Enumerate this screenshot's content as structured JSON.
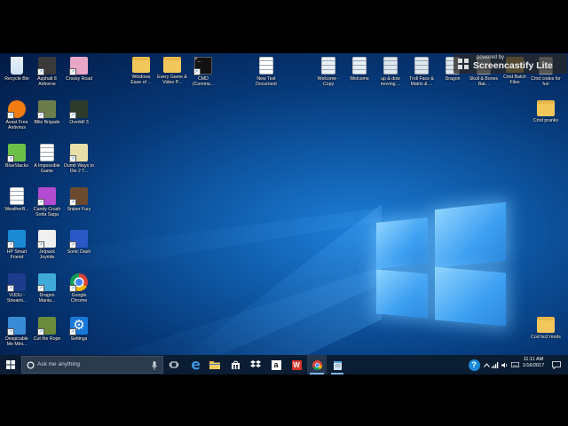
{
  "desktop": {
    "icons": [
      {
        "label": "Recycle Bin",
        "icon": "recycle-bin-icon",
        "color": "#cfe3f3"
      },
      {
        "label": "Asphalt 8 Airborne",
        "icon": "asphalt-icon",
        "color": "#3a3a3a"
      },
      {
        "label": "Crossy Road",
        "icon": "crossy-road-icon",
        "color": "#e9a7c7"
      },
      {
        "label": "Windows Ease of ...",
        "icon": "folder-icon",
        "color": "#f2c75c"
      },
      {
        "label": "Every Game & Video P...",
        "icon": "folder-icon",
        "color": "#f2c75c"
      },
      {
        "label": "CMD (Comma...",
        "icon": "terminal-icon",
        "color": "#111111"
      },
      {
        "label": "New Text Document",
        "icon": "text-file-icon",
        "color": "#ffffff"
      },
      {
        "label": "Welcome - Copy",
        "icon": "script-file-icon",
        "color": "#e8f0f7"
      },
      {
        "label": "Welcome",
        "icon": "script-file-icon",
        "color": "#e8f0f7"
      },
      {
        "label": "up & dow moving ...",
        "icon": "batch-file-icon",
        "color": "#dde6ee"
      },
      {
        "label": "Troll Face & Matrix & ...",
        "icon": "batch-file-icon",
        "color": "#dde6ee"
      },
      {
        "label": "Dragon",
        "icon": "batch-file-icon",
        "color": "#dde6ee"
      },
      {
        "label": "Skull & Bones Bat...",
        "icon": "batch-file-icon",
        "color": "#dde6ee"
      },
      {
        "label": "Cmd Batch Files",
        "icon": "folder-icon",
        "color": "#f2c75c"
      },
      {
        "label": "Cmd codes for fun",
        "icon": "text-file-icon",
        "color": "#ffffff"
      },
      {
        "label": "Avast Free Antivirus",
        "icon": "avast-icon",
        "color": "#f07c12"
      },
      {
        "label": "Blitz Brigade",
        "icon": "blitz-brigade-icon",
        "color": "#6b7d4a"
      },
      {
        "label": "Overkill 3",
        "icon": "overkill-icon",
        "color": "#2d3b2a"
      },
      {
        "label": "Cmd pranks",
        "icon": "folder-icon",
        "color": "#f2c75c"
      },
      {
        "label": "BlueStacks",
        "icon": "bluestacks-icon",
        "color": "#6cc04a"
      },
      {
        "label": "A Impossible Game",
        "icon": "text-file-icon",
        "color": "#ffffff"
      },
      {
        "label": "Dumb Ways to Die 2 T...",
        "icon": "dumb-ways-icon",
        "color": "#e8e0a8"
      },
      {
        "label": "WeatherB...",
        "icon": "text-file-icon",
        "color": "#ffffff"
      },
      {
        "label": "Candy Crush Soda Saga",
        "icon": "candy-crush-icon",
        "color": "#b34bd0"
      },
      {
        "label": "Sniper Fury",
        "icon": "sniper-fury-icon",
        "color": "#6b4a2e"
      },
      {
        "label": "HP Smart Friend",
        "icon": "hp-icon",
        "color": "#1a8ad4"
      },
      {
        "label": "Jetpack Joyride",
        "icon": "jetpack-icon",
        "color": "#f0f0f0"
      },
      {
        "label": "Sonic Dash",
        "icon": "sonic-icon",
        "color": "#2a58c6"
      },
      {
        "label": "VUDU - Streami...",
        "icon": "vudu-icon",
        "color": "#1c3b8a"
      },
      {
        "label": "Dragon Mania...",
        "icon": "dragon-mania-icon",
        "color": "#3fa9d8"
      },
      {
        "label": "Google Chrome",
        "icon": "chrome-icon",
        "color": "#db4437"
      },
      {
        "label": "Cod bo2 mods",
        "icon": "folder-icon",
        "color": "#f2c75c"
      },
      {
        "label": "Despicable Me Mini...",
        "icon": "despicable-me-icon",
        "color": "#3a8bd6"
      },
      {
        "label": "Cut the Rope",
        "icon": "cut-the-rope-icon",
        "color": "#6b8a3b"
      },
      {
        "label": "Settings",
        "icon": "settings-icon",
        "color": "#1979d8"
      }
    ]
  },
  "watermark": {
    "small": "powered by",
    "big": "Screencastify Lite"
  },
  "taskbar": {
    "search_placeholder": "Ask me anything",
    "clock_time": "11:11 AM",
    "clock_date": "1/16/2017",
    "pinned": [
      {
        "icon": "task-view-icon"
      },
      {
        "icon": "edge-icon"
      },
      {
        "icon": "file-explorer-icon"
      },
      {
        "icon": "store-icon"
      },
      {
        "icon": "dropbox-icon"
      },
      {
        "icon": "amazon-icon"
      },
      {
        "icon": "wps-office-icon"
      },
      {
        "icon": "chrome-icon"
      },
      {
        "icon": "notepad-icon"
      }
    ],
    "tray": [
      "help-icon",
      "chevron-up-icon",
      "network-icon",
      "volume-icon",
      "keyboard-icon"
    ]
  }
}
